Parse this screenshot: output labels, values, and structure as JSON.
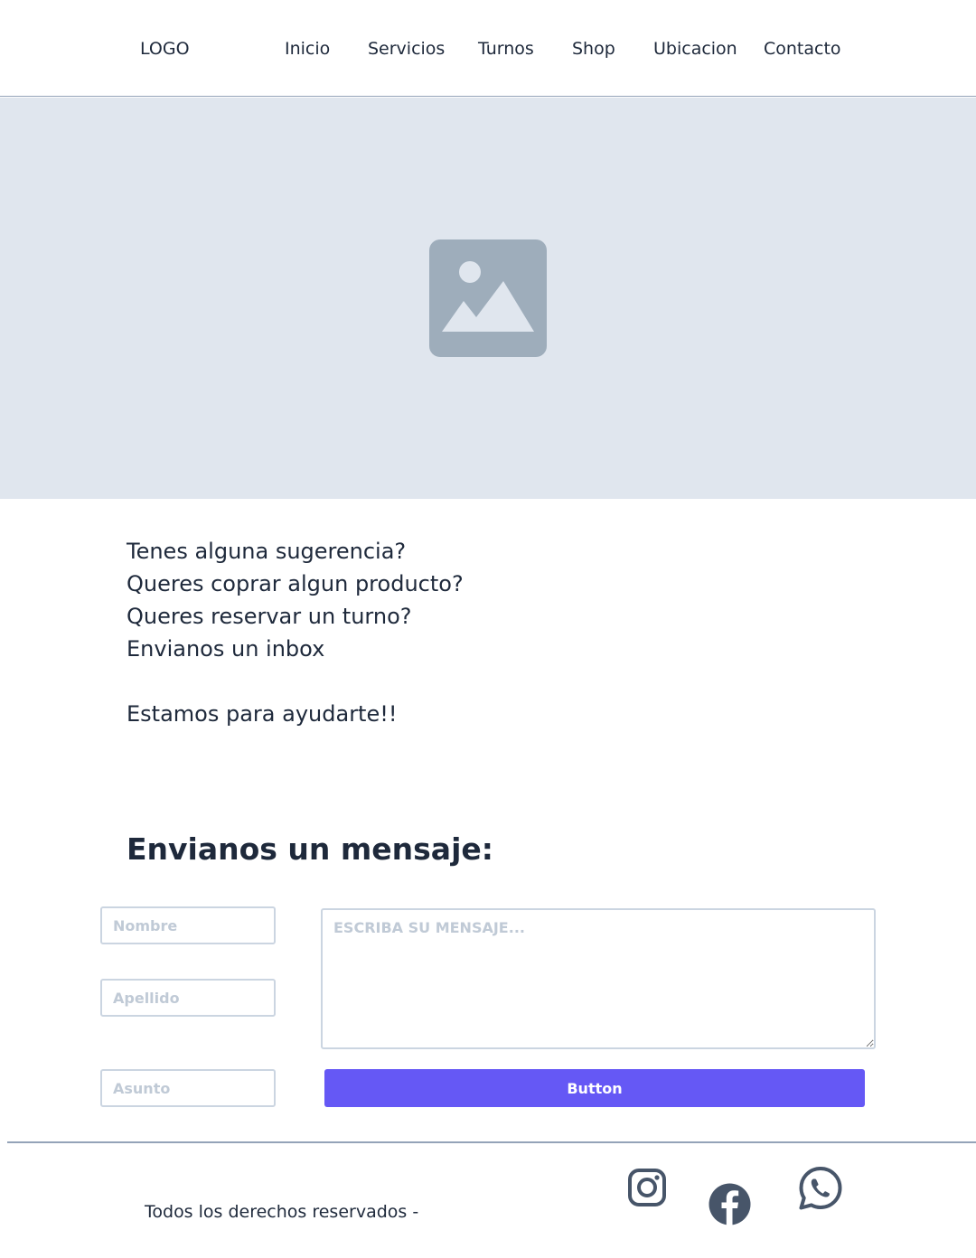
{
  "header": {
    "logo": "LOGO",
    "nav": [
      "Inicio",
      "Servicios",
      "Turnos",
      "Shop",
      "Ubicacion",
      "Contacto"
    ]
  },
  "hero": {
    "icon": "image-placeholder-icon"
  },
  "intro": {
    "lines": [
      "Tenes alguna sugerencia?",
      "Queres coprar algun producto?",
      "Queres reservar un turno?",
      "Envianos un inbox"
    ],
    "closing": "Estamos para ayudarte!!"
  },
  "form": {
    "title": "Envianos un mensaje:",
    "nombre_placeholder": "Nombre",
    "apellido_placeholder": "Apellido",
    "asunto_placeholder": "Asunto",
    "message_placeholder": "ESCRIBA SU MENSAJE...",
    "button_label": "Button"
  },
  "footer": {
    "copyright": "Todos los derechos reservados -",
    "social_icons": [
      "instagram-icon",
      "facebook-icon",
      "whatsapp-icon"
    ]
  },
  "colors": {
    "text": "#1e293b",
    "hero_bg": "#e0e6ee",
    "placeholder_icon": "#9eadbb",
    "button": "#6558f5",
    "border": "#cbd5e1",
    "social_icon": "#475569"
  }
}
